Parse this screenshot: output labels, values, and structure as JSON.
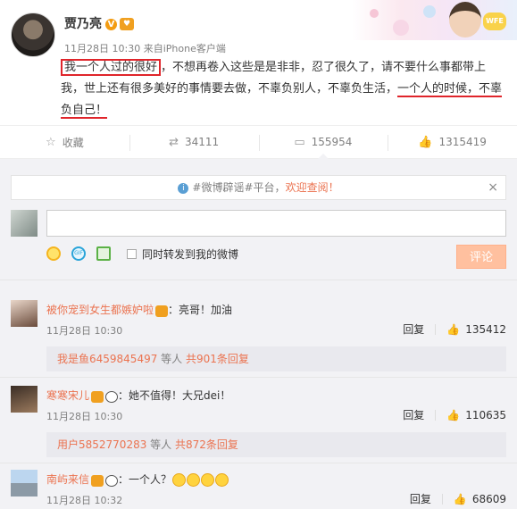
{
  "post": {
    "author": "贾乃亮",
    "verified_badge": "V",
    "time": "11月28日 10:30",
    "source_prefix": "来自",
    "source": "iPhone客户端",
    "text_part1": "我一个人过的很好",
    "text_part2": "，不想再卷入这些是是非非，忍了很久了，请不要什么事都带上我，世上还有很多美好的事情要去做，不辜负别人，不辜负生活，",
    "text_part3": "一个人的时候，不辜负自己！",
    "decoration_badge": "WFE"
  },
  "actions": [
    {
      "label": "收藏",
      "icon": "star-icon"
    },
    {
      "label": "34111",
      "icon": "repost-icon"
    },
    {
      "label": "155954",
      "icon": "comment-icon"
    },
    {
      "label": "1315419",
      "icon": "like-icon"
    }
  ],
  "notice": {
    "hash": "#微博辟谣#",
    "text": "平台，",
    "link": "欢迎查阅！",
    "close": "×"
  },
  "composer": {
    "gif_label": "GIF",
    "repost_label": "同时转发到我的微博",
    "submit_label": "评论"
  },
  "comments": [
    {
      "user": "被你宠到女生都嫉妒啦",
      "text": "：亮哥！加油",
      "time": "11月28日 10:30",
      "reply_label": "回复",
      "likes": "135412",
      "sub_user": "我是鱼6459845497",
      "sub_mid": " 等人 ",
      "sub_count": "共901条回复"
    },
    {
      "user": "寒寒宋儿",
      "text": "：她不值得！大兄dei！",
      "time": "11月28日 10:30",
      "reply_label": "回复",
      "likes": "110635",
      "sub_user": "用户5852770283",
      "sub_mid": " 等人 ",
      "sub_count": "共872条回复"
    },
    {
      "user": "南屿来信",
      "text": "：一个人？",
      "time": "11月28日 10:32",
      "reply_label": "回复",
      "likes": "68609"
    }
  ]
}
